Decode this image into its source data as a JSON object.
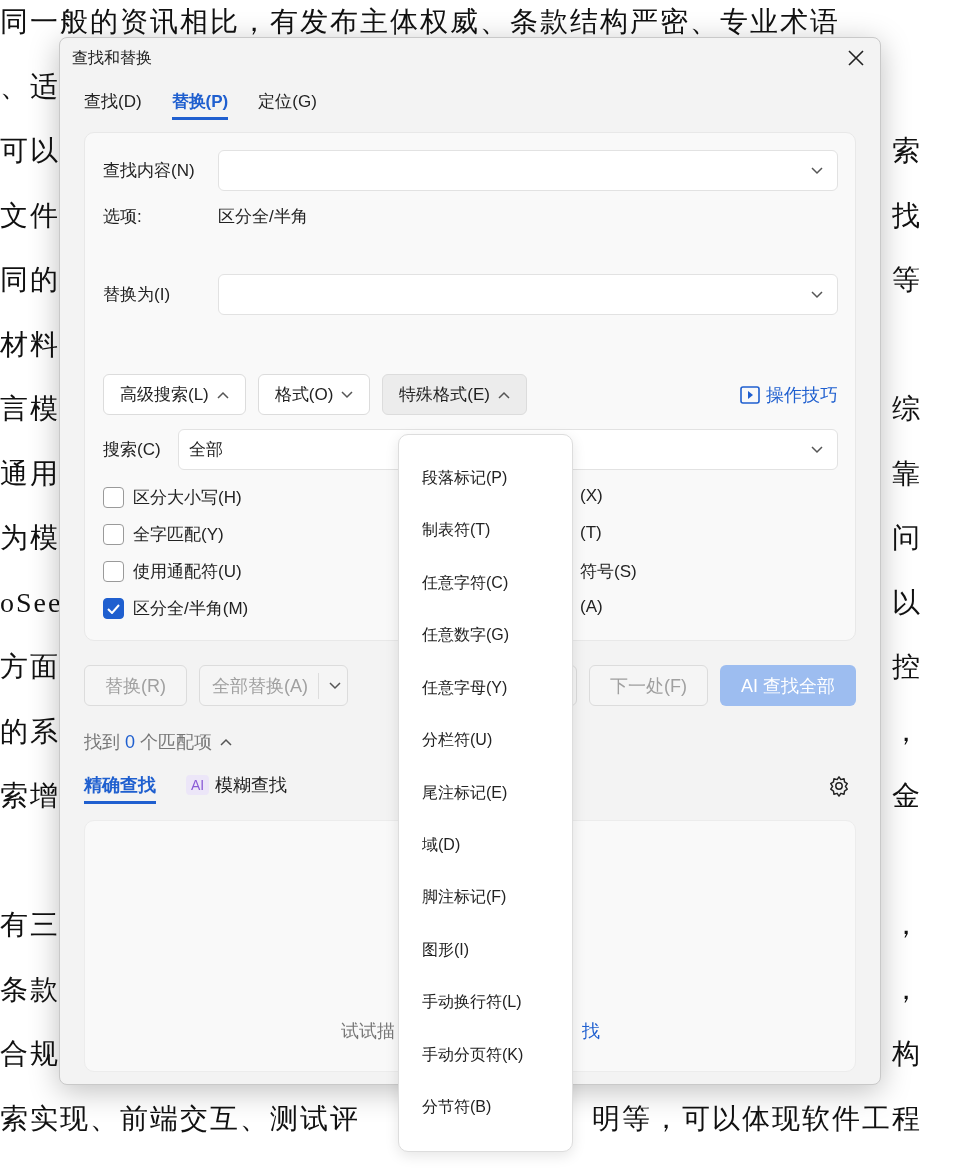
{
  "document": {
    "lines": [
      {
        "kind": "text",
        "left": "同一般的资讯相比，有发布主体权威、条款结构严密、专业术语"
      },
      {
        "kind": "text",
        "left": "、适"
      },
      {
        "kind": "text",
        "left": "可以",
        "right": "索"
      },
      {
        "kind": "text",
        "left": "文件",
        "right": "找"
      },
      {
        "kind": "text",
        "left": "同的",
        "right": "等"
      },
      {
        "kind": "text",
        "left": "材料"
      },
      {
        "kind": "text",
        "left": "言模",
        "right": "综"
      },
      {
        "kind": "text",
        "left": "通用",
        "right": "靠"
      },
      {
        "kind": "text",
        "left": "为模",
        "right": "问"
      },
      {
        "kind": "text",
        "left": "oSee",
        "right": "以"
      },
      {
        "kind": "text",
        "left": "方面",
        "right": "控"
      },
      {
        "kind": "text",
        "left": "的系",
        "right": "，"
      },
      {
        "kind": "text",
        "left": "索增",
        "right": "金"
      },
      {
        "kind": "blank"
      },
      {
        "kind": "text",
        "left": "有三",
        "right": "，"
      },
      {
        "kind": "text",
        "left": "条款",
        "right": "，"
      },
      {
        "kind": "text",
        "left": "合规",
        "right": "构"
      },
      {
        "kind": "text",
        "left": "索实现、前端交互、测试评",
        "right": "明等，可以体现软件工程"
      }
    ]
  },
  "dialog": {
    "title": "查找和替换",
    "tabs": [
      {
        "label": "查找(D)",
        "selected": false
      },
      {
        "label": "替换(P)",
        "selected": true
      },
      {
        "label": "定位(G)",
        "selected": false
      }
    ],
    "find": {
      "label": "查找内容(N)"
    },
    "options": {
      "label": "选项:",
      "value": "区分全/半角"
    },
    "replace": {
      "label": "替换为(I)"
    },
    "toolbar": [
      {
        "label": "高级搜索(L)",
        "expanded": true,
        "active": false
      },
      {
        "label": "格式(O)",
        "expanded": false,
        "active": false
      },
      {
        "label": "特殊格式(E)",
        "expanded": true,
        "active": true
      }
    ],
    "tips_link": "操作技巧",
    "search": {
      "label": "搜索(C)",
      "value": "全部"
    },
    "checkboxes": [
      {
        "label": "区分大小写(H)",
        "checked": false
      },
      {
        "label": "全字匹配(Y)",
        "checked": false
      },
      {
        "label": "使用通配符(U)",
        "checked": false
      },
      {
        "label": "区分全/半角(M)",
        "checked": true
      }
    ],
    "right_options": [
      "(X)",
      "(T)",
      "符号(S)",
      "(A)"
    ],
    "actions": [
      {
        "kind": "plain",
        "label": "替换(R)",
        "disabled": true
      },
      {
        "kind": "split",
        "label": "全部替换(A)",
        "disabled": true
      },
      {
        "kind": "hidden"
      },
      {
        "kind": "plain",
        "label": "下一处(F)",
        "disabled": true
      },
      {
        "kind": "primary",
        "label": "AI 查找全部",
        "disabled": true
      }
    ],
    "match_summary": {
      "prefix": "找到",
      "count": "0",
      "suffix": "个匹配项",
      "expanded": true
    },
    "mode_tabs": [
      {
        "label": "精确查找",
        "selected": true
      },
      {
        "label": "模糊查找",
        "badge": "AI",
        "selected": false
      }
    ],
    "hint": {
      "text": "试试描",
      "link": "找"
    }
  },
  "menu": {
    "items": [
      "段落标记(P)",
      "制表符(T)",
      "任意字符(C)",
      "任意数字(G)",
      "任意字母(Y)",
      "分栏符(U)",
      "尾注标记(E)",
      "域(D)",
      "脚注标记(F)",
      "图形(I)",
      "手动换行符(L)",
      "手动分页符(K)",
      "分节符(B)"
    ]
  }
}
